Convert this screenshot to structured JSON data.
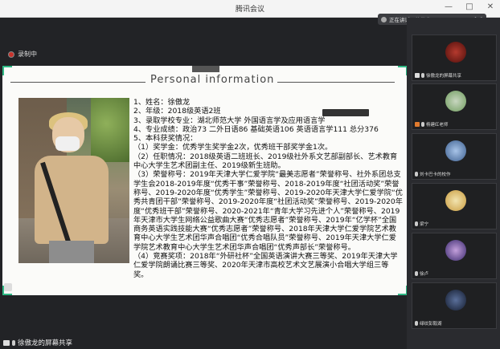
{
  "window": {
    "title": "腾讯会议",
    "controls": [
      "minimize-icon",
      "maximize-icon",
      "close-icon"
    ]
  },
  "recording": {
    "label": "录制中"
  },
  "speaking": {
    "text": "正在讲话：徐傲龙;"
  },
  "slide": {
    "title": "Personal  information",
    "lines": [
      "1、姓名：徐傲龙",
      "2、年级：2018级英语2班",
      "3、录取学校专业：湖北师范大学 外国语言学及应用语言学",
      "4、专业成绩：政治73 二外日语86 基础英语106 英语语言学111 总分376",
      "5、本科获奖情况：",
      "（1）奖学金：优秀学生奖学金2次，优秀班干部奖学金1次。",
      "（2）任职情况：2018级英语二班班长、2019级社外系文艺部副部长、艺术教育中心大学生艺术团副主任、2019级新生班助。",
      "（3）荣誉称号：2019年天津大学仁爱学院“最美志愿者”荣誉称号、社外系团总支学生会2018-2019年度“优秀干事”荣誉称号、2018-2019年度“社团活动奖”荣誉称号、2019-2020年度“优秀学生”荣誉称号、2019-2020年天津大学仁爱学院“优秀共青团干部”荣誉称号、2019-2020年度“社团活动奖”荣誉称号、2019-2020年度“优秀班干部”荣誉称号、2020-2021年“青年大学习先进个人”荣誉称号、2019年天津市大学生网络公益歌曲大赛“优秀志愿者”荣誉称号、2019年“亿学杯”全国商务英语实践技能大赛“优秀志愿者”荣誉称号、2018年天津大学仁爱学院艺术教育中心大学生艺术团华声合唱团“优秀合唱队员”荣誉称号、2019年天津大学仁爱学院艺术教育中心大学生艺术团华声合唱团“优秀声部长”荣誉称号。",
      "（4）竞赛奖项：2018年“外研社杯”全国英语演讲大赛三等奖、2019年天津大学仁爱学院朗诵比赛三等奖、2020年天津市高校艺术文艺展演小合唱大学组三等奖。"
    ]
  },
  "share_label": "徐傲龙的屏幕共享",
  "participants": [
    {
      "name": "徐傲龙的屏幕共享",
      "color": "#7a1a18"
    },
    {
      "name": "杨建红老师",
      "color": "#dfe7e2"
    },
    {
      "name": "刘卡巴卡的校作",
      "color": "#6d8fc0"
    },
    {
      "name": "梁宁",
      "color": "#e4cc7a"
    },
    {
      "name": "徐卢",
      "color": "#7a4f9a"
    },
    {
      "name": "绿纹彭毅湖",
      "color": "#2f3b58"
    }
  ]
}
